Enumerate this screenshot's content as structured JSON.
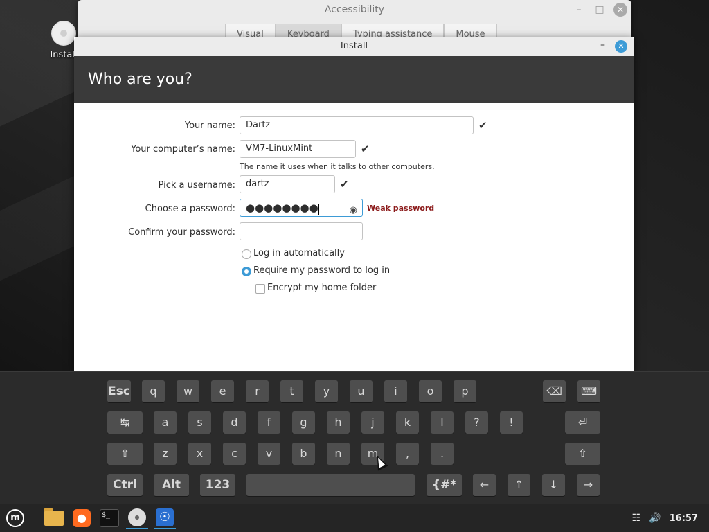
{
  "desktop": {
    "icon_label": "Install"
  },
  "accessibility_window": {
    "title": "Accessibility",
    "tabs": [
      "Visual",
      "Keyboard",
      "Typing assistance",
      "Mouse"
    ],
    "active_tab": "Keyboard"
  },
  "install_window": {
    "title": "Install",
    "header": "Who are you?",
    "fields": {
      "name": {
        "label": "Your name:",
        "value": "Dartz"
      },
      "computer": {
        "label": "Your computer’s name:",
        "value": "VM7-LinuxMint",
        "hint": "The name it uses when it talks to other computers."
      },
      "username": {
        "label": "Pick a username:",
        "value": "dartz"
      },
      "password": {
        "label": "Choose a password:",
        "value": "●●●●●●●●",
        "strength": "Weak password"
      },
      "confirm": {
        "label": "Confirm your password:",
        "value": ""
      }
    },
    "options": {
      "auto_login": "Log in automatically",
      "require_password": "Require my password to log in",
      "encrypt_home": "Encrypt my home folder"
    },
    "check_glyph": "✔"
  },
  "keyboard": {
    "row1": [
      "Esc",
      "q",
      "w",
      "e",
      "r",
      "t",
      "y",
      "u",
      "i",
      "o",
      "p",
      "⌫",
      "⌨"
    ],
    "row2": [
      "↹",
      "a",
      "s",
      "d",
      "f",
      "g",
      "h",
      "j",
      "k",
      "l",
      "?",
      "!",
      "⏎"
    ],
    "row3": [
      "⇧",
      "z",
      "x",
      "c",
      "v",
      "b",
      "n",
      "m",
      ",",
      ".",
      "⇧"
    ],
    "row4": [
      "Ctrl",
      "Alt",
      "123",
      " ",
      "{#*",
      "←",
      "↑",
      "↓",
      "→"
    ]
  },
  "taskbar": {
    "clock": "16:57",
    "icons": [
      "mint-menu-icon",
      "files-icon",
      "firefox-icon",
      "terminal-icon",
      "installer-icon",
      "accessibility-icon"
    ]
  }
}
